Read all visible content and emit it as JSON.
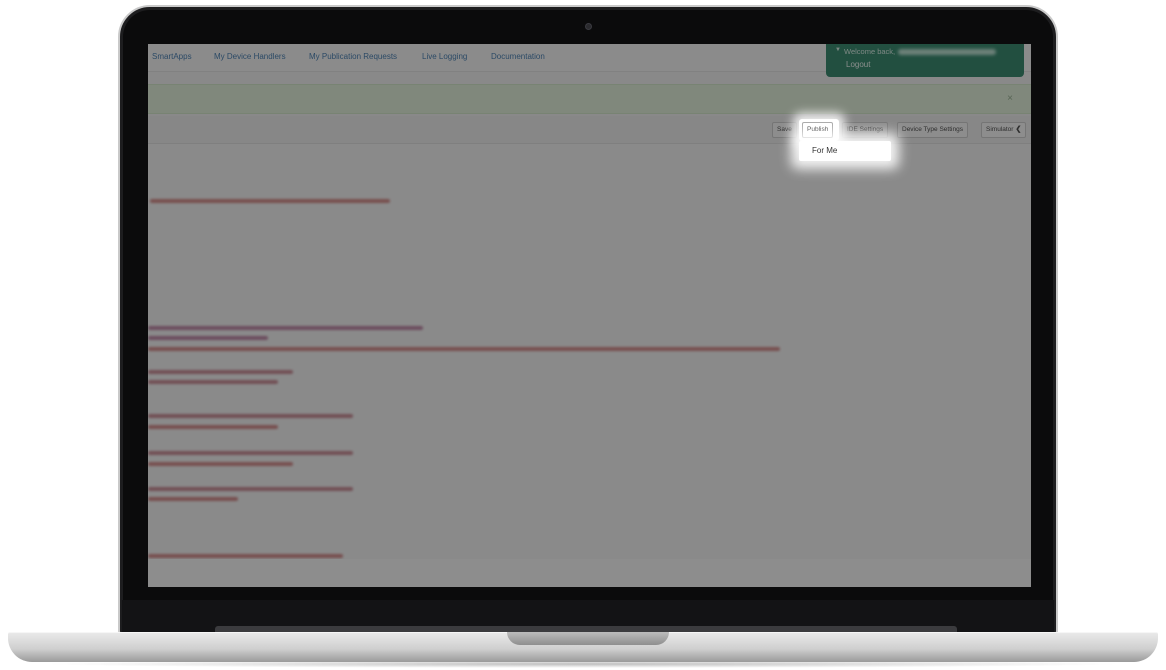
{
  "nav": {
    "items": [
      "SmartApps",
      "My Device Handlers",
      "My Publication Requests",
      "Live Logging",
      "Documentation"
    ]
  },
  "account": {
    "welcome_prefix": "Welcome back,",
    "logout_label": "Logout"
  },
  "alert": {
    "close_label": "×"
  },
  "toolbar": {
    "save_label": "Save",
    "publish_label": "Publish",
    "ide_settings_label": "IDE Settings",
    "device_type_settings_label": "Device Type Settings",
    "simulator_label": "Simulator"
  },
  "publish_menu": {
    "items": [
      "For Me"
    ]
  },
  "icons": {
    "welcome_caret": "caret-down-icon",
    "simulator_chevron": "chevron-left-icon"
  },
  "colors": {
    "nav_link": "#2f6ea8",
    "account_box": "#1c7a5b",
    "alert_bg": "#dff0d8"
  }
}
